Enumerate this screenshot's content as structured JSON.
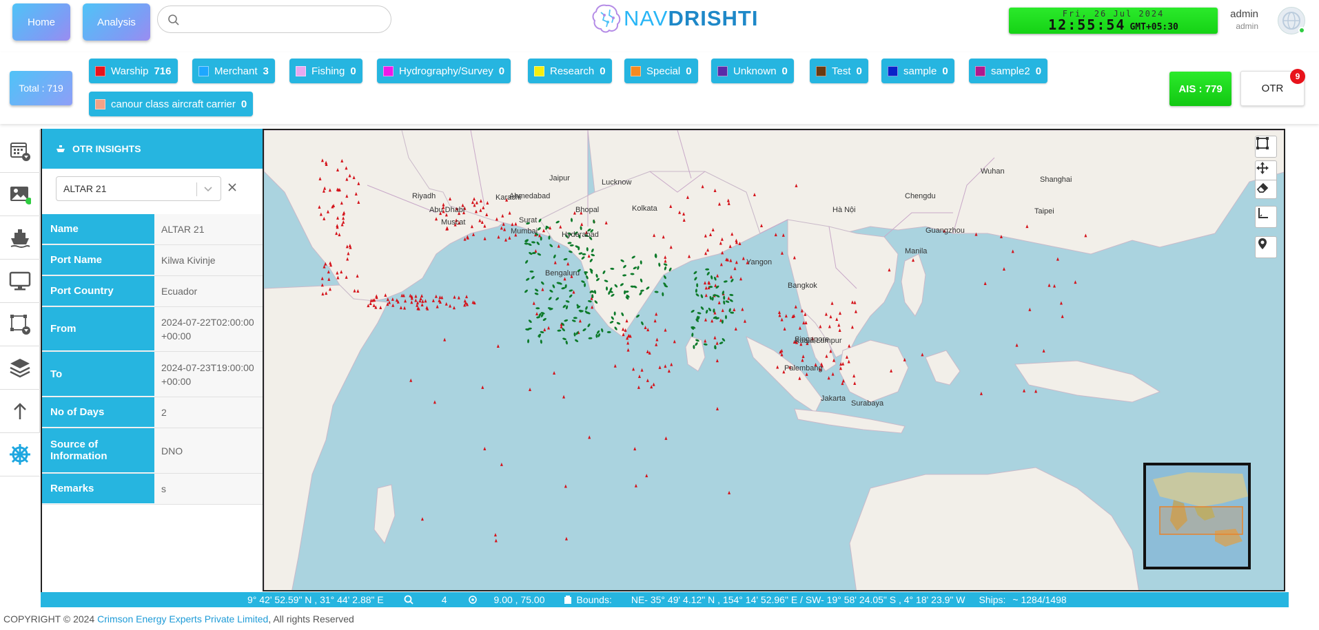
{
  "header": {
    "home_label": "Home",
    "analysis_label": "Analysis",
    "search_placeholder": "",
    "logo_a": "NAV",
    "logo_b": "DRISHTI",
    "clock_date": "Fri, 26 Jul 2024",
    "clock_time": "12:55:54",
    "clock_tz": "GMT+05:30",
    "user_name": "admin",
    "user_role": "admin"
  },
  "categories": {
    "total_label": "Total : 719",
    "chips": [
      {
        "label": "Warship",
        "count": "716",
        "color": "#e8131b"
      },
      {
        "label": "Merchant",
        "count": "3",
        "color": "#1ea7ff"
      },
      {
        "label": "Fishing",
        "count": "0",
        "color": "#e7a8f0"
      },
      {
        "label": "Hydrography/Survey",
        "count": "0",
        "color": "#ee19e8"
      },
      {
        "label": "Research",
        "count": "0",
        "color": "#f6ee0d"
      },
      {
        "label": "Special",
        "count": "0",
        "color": "#f58a20"
      },
      {
        "label": "Unknown",
        "count": "0",
        "color": "#5a2aa8"
      },
      {
        "label": "Test",
        "count": "0",
        "color": "#6a3b12"
      },
      {
        "label": "sample",
        "count": "0",
        "color": "#0a22c8"
      },
      {
        "label": "sample2",
        "count": "0",
        "color": "#b0198c"
      },
      {
        "label": "canour class aircraft carrier",
        "count": "0",
        "color": "#f3a286"
      }
    ],
    "ais_label": "AIS : 779",
    "otr_label": "OTR",
    "otr_badge": "9"
  },
  "panel": {
    "title": "OTR INSIGHTS",
    "selected": "ALTAR 21",
    "rows": [
      {
        "key": "Name",
        "value": "ALTAR 21"
      },
      {
        "key": "Port Name",
        "value": "Kilwa Kivinje"
      },
      {
        "key": "Port Country",
        "value": "Ecuador"
      },
      {
        "key": "From",
        "value": "2024-07-22T02:00:00+00:00"
      },
      {
        "key": "To",
        "value": "2024-07-23T19:00:00+00:00"
      },
      {
        "key": "No of Days",
        "value": "2"
      },
      {
        "key": "Source of Information",
        "value": "DNO"
      },
      {
        "key": "Remarks",
        "value": "s"
      }
    ]
  },
  "map_labels": [
    "Ahmedabad",
    "Bhopal",
    "Lucknow",
    "Jaipur",
    "Surat",
    "Mumbai",
    "Hyderabad",
    "Bengaluru",
    "Kolkata",
    "Singapore",
    "Palembang",
    "Jakarta",
    "Surabaya",
    "Manila",
    "Hà Nội",
    "Abu Dhabi",
    "Muscat",
    "Riyadh",
    "Karachi",
    "Yangon",
    "Bangkok",
    "Kuala Lumpur",
    "Guangzhou",
    "Wuhan",
    "Chengdu",
    "Shanghai",
    "Taipei"
  ],
  "status": {
    "coords": "9° 42' 52.59\" N , 31° 44' 2.88\" E",
    "zoom": "4",
    "center": "9.00 , 75.00",
    "bounds_label": "Bounds:",
    "bounds_value": "NE- 35° 49' 4.12\" N , 154° 14' 52.96\" E / SW- 19° 58' 24.05\" S , 4° 18' 23.9\" W",
    "ships_label": "Ships:",
    "ships_value": "~ 1284/1498"
  },
  "footer": {
    "prefix": "COPYRIGHT © 2024 ",
    "company": "Crimson Energy Experts Private Limited",
    "suffix": ", All rights Reserved"
  },
  "colors": {
    "accent": "#26b5e0",
    "ais_green": "#16d516",
    "badge_red": "#e8131b",
    "water": "#aad3df",
    "land": "#f2efe9"
  }
}
